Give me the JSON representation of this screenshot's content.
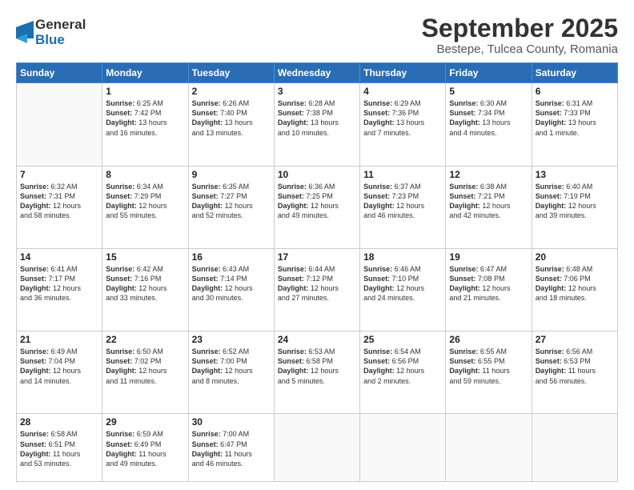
{
  "logo": {
    "general": "General",
    "blue": "Blue"
  },
  "header": {
    "month": "September 2025",
    "location": "Bestepe, Tulcea County, Romania"
  },
  "weekdays": [
    "Sunday",
    "Monday",
    "Tuesday",
    "Wednesday",
    "Thursday",
    "Friday",
    "Saturday"
  ],
  "weeks": [
    [
      {
        "day": "",
        "content": ""
      },
      {
        "day": "1",
        "content": "Sunrise: 6:25 AM\nSunset: 7:42 PM\nDaylight: 13 hours\nand 16 minutes."
      },
      {
        "day": "2",
        "content": "Sunrise: 6:26 AM\nSunset: 7:40 PM\nDaylight: 13 hours\nand 13 minutes."
      },
      {
        "day": "3",
        "content": "Sunrise: 6:28 AM\nSunset: 7:38 PM\nDaylight: 13 hours\nand 10 minutes."
      },
      {
        "day": "4",
        "content": "Sunrise: 6:29 AM\nSunset: 7:36 PM\nDaylight: 13 hours\nand 7 minutes."
      },
      {
        "day": "5",
        "content": "Sunrise: 6:30 AM\nSunset: 7:34 PM\nDaylight: 13 hours\nand 4 minutes."
      },
      {
        "day": "6",
        "content": "Sunrise: 6:31 AM\nSunset: 7:33 PM\nDaylight: 13 hours\nand 1 minute."
      }
    ],
    [
      {
        "day": "7",
        "content": "Sunrise: 6:32 AM\nSunset: 7:31 PM\nDaylight: 12 hours\nand 58 minutes."
      },
      {
        "day": "8",
        "content": "Sunrise: 6:34 AM\nSunset: 7:29 PM\nDaylight: 12 hours\nand 55 minutes."
      },
      {
        "day": "9",
        "content": "Sunrise: 6:35 AM\nSunset: 7:27 PM\nDaylight: 12 hours\nand 52 minutes."
      },
      {
        "day": "10",
        "content": "Sunrise: 6:36 AM\nSunset: 7:25 PM\nDaylight: 12 hours\nand 49 minutes."
      },
      {
        "day": "11",
        "content": "Sunrise: 6:37 AM\nSunset: 7:23 PM\nDaylight: 12 hours\nand 46 minutes."
      },
      {
        "day": "12",
        "content": "Sunrise: 6:38 AM\nSunset: 7:21 PM\nDaylight: 12 hours\nand 42 minutes."
      },
      {
        "day": "13",
        "content": "Sunrise: 6:40 AM\nSunset: 7:19 PM\nDaylight: 12 hours\nand 39 minutes."
      }
    ],
    [
      {
        "day": "14",
        "content": "Sunrise: 6:41 AM\nSunset: 7:17 PM\nDaylight: 12 hours\nand 36 minutes."
      },
      {
        "day": "15",
        "content": "Sunrise: 6:42 AM\nSunset: 7:16 PM\nDaylight: 12 hours\nand 33 minutes."
      },
      {
        "day": "16",
        "content": "Sunrise: 6:43 AM\nSunset: 7:14 PM\nDaylight: 12 hours\nand 30 minutes."
      },
      {
        "day": "17",
        "content": "Sunrise: 6:44 AM\nSunset: 7:12 PM\nDaylight: 12 hours\nand 27 minutes."
      },
      {
        "day": "18",
        "content": "Sunrise: 6:46 AM\nSunset: 7:10 PM\nDaylight: 12 hours\nand 24 minutes."
      },
      {
        "day": "19",
        "content": "Sunrise: 6:47 AM\nSunset: 7:08 PM\nDaylight: 12 hours\nand 21 minutes."
      },
      {
        "day": "20",
        "content": "Sunrise: 6:48 AM\nSunset: 7:06 PM\nDaylight: 12 hours\nand 18 minutes."
      }
    ],
    [
      {
        "day": "21",
        "content": "Sunrise: 6:49 AM\nSunset: 7:04 PM\nDaylight: 12 hours\nand 14 minutes."
      },
      {
        "day": "22",
        "content": "Sunrise: 6:50 AM\nSunset: 7:02 PM\nDaylight: 12 hours\nand 11 minutes."
      },
      {
        "day": "23",
        "content": "Sunrise: 6:52 AM\nSunset: 7:00 PM\nDaylight: 12 hours\nand 8 minutes."
      },
      {
        "day": "24",
        "content": "Sunrise: 6:53 AM\nSunset: 6:58 PM\nDaylight: 12 hours\nand 5 minutes."
      },
      {
        "day": "25",
        "content": "Sunrise: 6:54 AM\nSunset: 6:56 PM\nDaylight: 12 hours\nand 2 minutes."
      },
      {
        "day": "26",
        "content": "Sunrise: 6:55 AM\nSunset: 6:55 PM\nDaylight: 11 hours\nand 59 minutes."
      },
      {
        "day": "27",
        "content": "Sunrise: 6:56 AM\nSunset: 6:53 PM\nDaylight: 11 hours\nand 56 minutes."
      }
    ],
    [
      {
        "day": "28",
        "content": "Sunrise: 6:58 AM\nSunset: 6:51 PM\nDaylight: 11 hours\nand 53 minutes."
      },
      {
        "day": "29",
        "content": "Sunrise: 6:59 AM\nSunset: 6:49 PM\nDaylight: 11 hours\nand 49 minutes."
      },
      {
        "day": "30",
        "content": "Sunrise: 7:00 AM\nSunset: 6:47 PM\nDaylight: 11 hours\nand 46 minutes."
      },
      {
        "day": "",
        "content": ""
      },
      {
        "day": "",
        "content": ""
      },
      {
        "day": "",
        "content": ""
      },
      {
        "day": "",
        "content": ""
      }
    ]
  ]
}
